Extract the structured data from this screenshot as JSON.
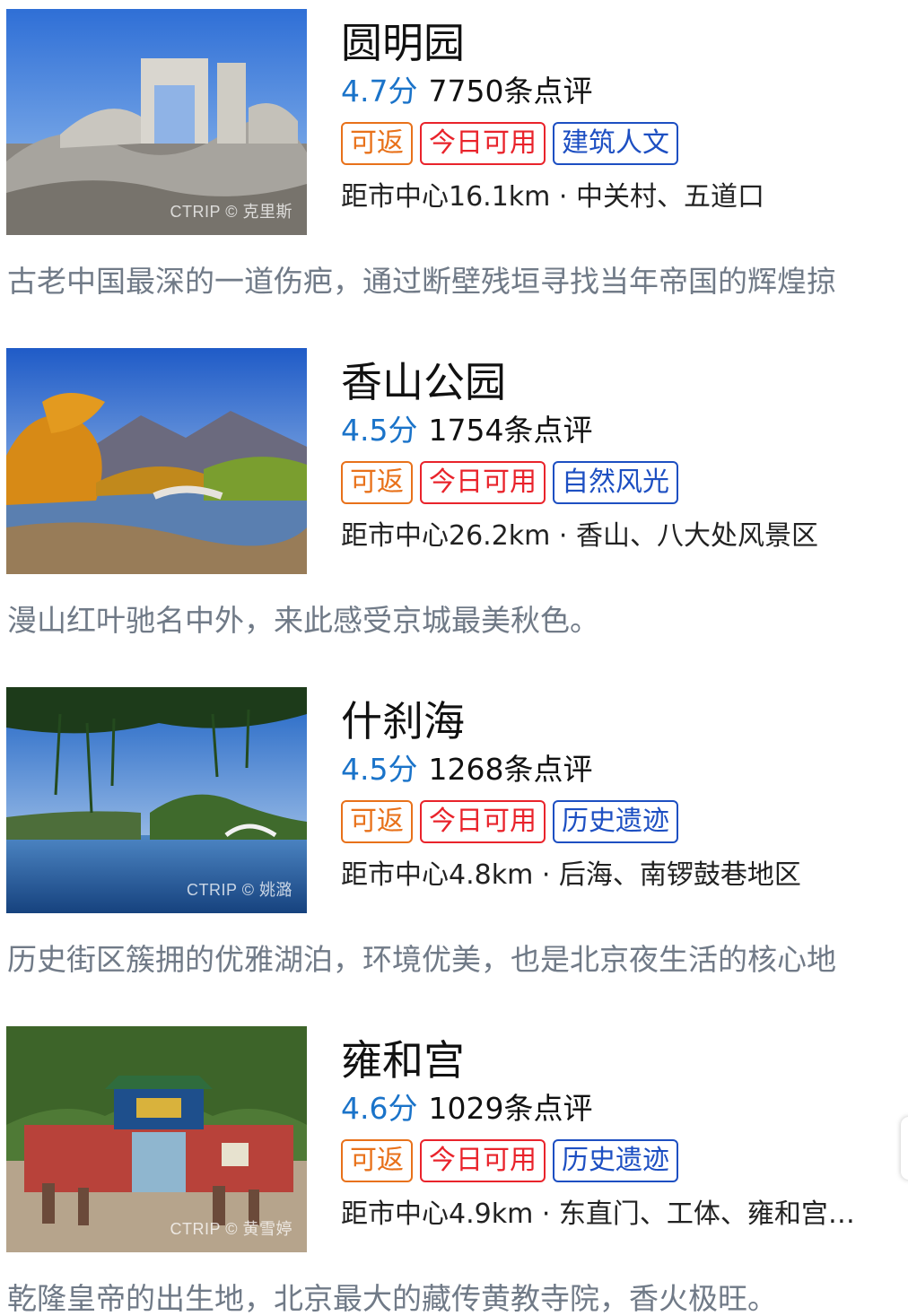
{
  "attractions": [
    {
      "name": "圆明园",
      "score": "4.7分",
      "reviews": "7750条点评",
      "tags": [
        "可返",
        "今日可用",
        "建筑人文"
      ],
      "location": "距市中心16.1km · 中关村、五道口",
      "description": "古老中国最深的一道伤疤，通过断壁残垣寻找当年帝国的辉煌掠",
      "watermark": "CTRIP © 克里斯"
    },
    {
      "name": "香山公园",
      "score": "4.5分",
      "reviews": "1754条点评",
      "tags": [
        "可返",
        "今日可用",
        "自然风光"
      ],
      "location": "距市中心26.2km · 香山、八大处风景区",
      "description": "漫山红叶驰名中外，来此感受京城最美秋色。",
      "watermark": ""
    },
    {
      "name": "什刹海",
      "score": "4.5分",
      "reviews": "1268条点评",
      "tags": [
        "可返",
        "今日可用",
        "历史遗迹"
      ],
      "location": "距市中心4.8km · 后海、南锣鼓巷地区",
      "description": "历史街区簇拥的优雅湖泊，环境优美，也是北京夜生活的核心地",
      "watermark": "CTRIP © 姚潞"
    },
    {
      "name": "雍和宫",
      "score": "4.6分",
      "reviews": "1029条点评",
      "tags": [
        "可返",
        "今日可用",
        "历史遗迹"
      ],
      "location": "距市中心4.9km · 东直门、工体、雍和宫…",
      "description": "乾隆皇帝的出生地，北京最大的藏传黄教寺院，香火极旺。",
      "watermark": "CTRIP © 黄雪婷"
    }
  ],
  "colors": {
    "score": "#1a73c9",
    "tag_refund": "#e8711a",
    "tag_today": "#e9232b",
    "tag_category": "#1d4fc2",
    "description": "#707a87"
  }
}
